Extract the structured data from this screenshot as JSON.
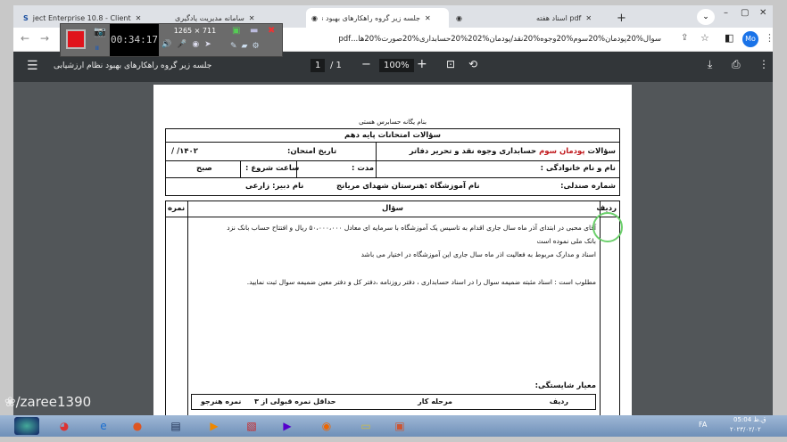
{
  "browser": {
    "tabs": [
      {
        "label": "ject Enterprise 10.8 - Client"
      },
      {
        "label": "سامانه مدیریت یادگیری"
      },
      {
        "label": "جلسه زیر گروه راهکارهای بهبود نظام ارز..."
      },
      {
        "label": ""
      },
      {
        "label": "اسناد هفته pdf"
      }
    ],
    "profile": "Mo",
    "url": "سوال%20پودمان%20سوم%20وجوه%20نقد/پودمان%202%20حسابداری%20صورت%20ها...pdf"
  },
  "recorder": {
    "timer": "00:34:17",
    "resolution": "1265 × 711"
  },
  "pdf": {
    "title": "جلسه زیر گروه راهکارهای بهبود نظام ارزشیابی",
    "page_current": "1",
    "page_total": "/ 1",
    "zoom": "100%"
  },
  "doc": {
    "bismillah": "بنام یگانه حسابرس هستی",
    "header": "سؤالات امتحانات پایه دهم",
    "subject_prefix": "سؤالات",
    "subject_red": "پودمان سوم",
    "subject_rest": "حسابداری وجوه نقد و تحریر دفاتر",
    "exam_date_label": "تاریخ امتحان:",
    "exam_date_value": "/    /۱۴۰۲",
    "name_label": "نام و نام خانوادگی :",
    "duration_label": "مدت :",
    "start_label": "ساعت شروع :",
    "start_value": "صبح",
    "seat_label": "شماره صندلی:",
    "school": "نام آموزشگاه :هنرستان شهدای مریانج",
    "teacher": "نام دبیر:  زارعی",
    "col_row": "ردیف",
    "col_question": "سؤال",
    "col_score": "نمره",
    "q_line1": "آقای محبی در ابتدای آذر ماه سال جاری  اقدام به تاسیس یک آموزشگاه با سرمایه ای معادل ۵۰،۰۰۰،۰۰۰ ریال و افتتاح حساب بانک نزد",
    "q_line2": "بانک ملی نموده است",
    "q_line3": "اسناد و مدارک مربوط به فعالیت اذر ماه سال جاری این آموزشگاه در اختیار می باشد",
    "q_line4": "مطلوب است : اسناد مثبته ضمیمه سوال را در اسناد حسابداری ، دفتر روزنامه ،دفتر کل و دفتر معین ضمیمه سوال ثبت نمایید.",
    "criteria": "معیار شایستگی:",
    "c_row": "ردیف",
    "c_stage": "مرحله کار",
    "c_min": "حداقل نمره قبولی از ۳",
    "c_score": "نمره هنرجو"
  },
  "watermark": "/zaree1390",
  "taskbar": {
    "lang": "FA",
    "time": "05:04 ق.ظ",
    "date": "۲۰۲۳/۰۲/۰۲"
  }
}
